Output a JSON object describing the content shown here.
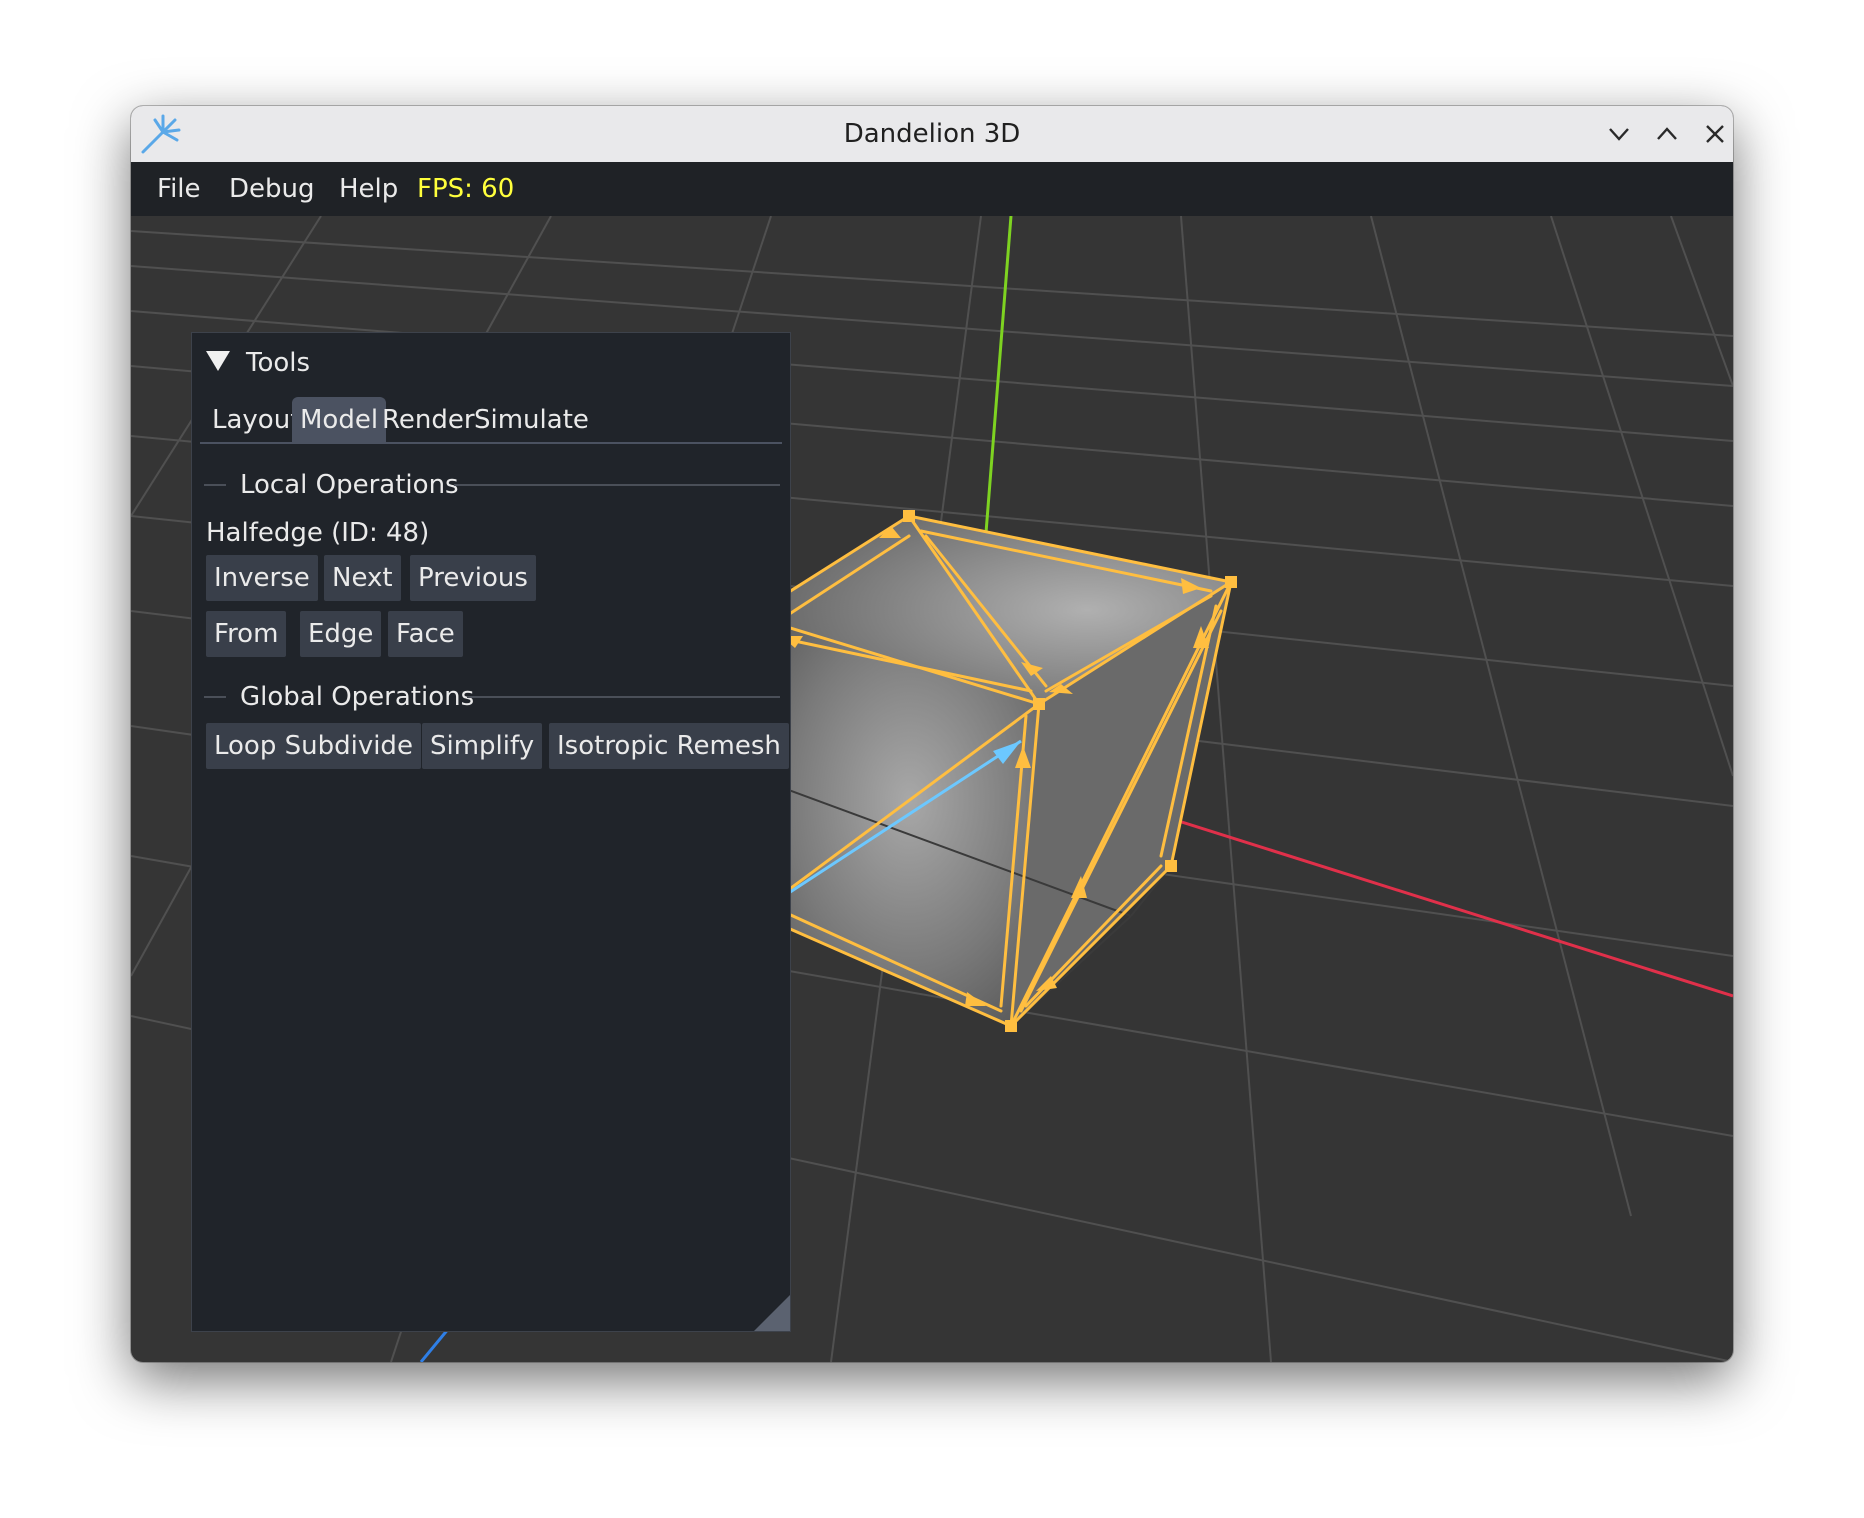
{
  "window": {
    "title": "Dandelion 3D"
  },
  "menubar": {
    "items": [
      "File",
      "Debug",
      "Help"
    ],
    "fps": "FPS: 60"
  },
  "panel": {
    "title": "Tools",
    "tabs": [
      "Layout",
      "Model",
      "Render",
      "Simulate"
    ],
    "active_tab": "Model",
    "local_section": "Local Operations",
    "selection": "Halfedge (ID: 48)",
    "local_buttons_row1": [
      "Inverse",
      "Next",
      "Previous"
    ],
    "local_buttons_row2": [
      "From",
      "Edge",
      "Face"
    ],
    "global_section": "Global Operations",
    "global_buttons": [
      "Loop Subdivide",
      "Simplify",
      "Isotropic Remesh"
    ]
  },
  "icons": {
    "app": "dandelion-icon",
    "minimize": "chevron-down-icon",
    "maximize": "chevron-up-icon",
    "close": "close-icon"
  },
  "colors": {
    "selection": "#ffbe40",
    "selected_halfedge": "#6cc8ff",
    "axis_x": "#e0304a",
    "axis_y": "#7ed321",
    "axis_z": "#2f7fe6",
    "background": "#353535",
    "fps": "#ffff3c"
  }
}
